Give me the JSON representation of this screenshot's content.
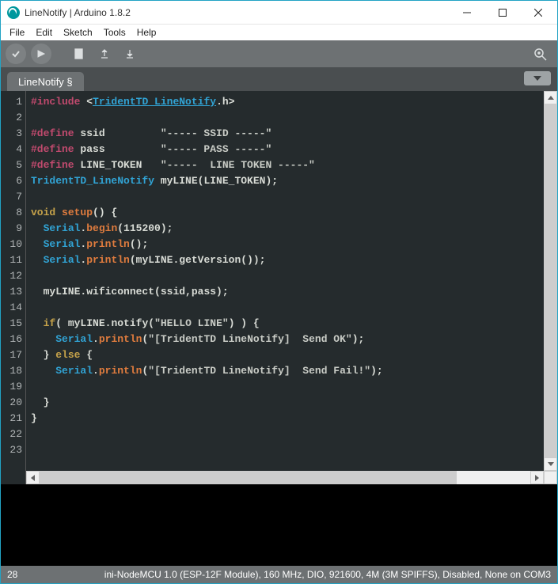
{
  "titlebar": {
    "title": "LineNotify | Arduino 1.8.2"
  },
  "menubar": {
    "items": [
      "File",
      "Edit",
      "Sketch",
      "Tools",
      "Help"
    ]
  },
  "tab": {
    "label": "LineNotify §"
  },
  "code": {
    "lines": [
      [
        [
          "c-prep",
          "#include"
        ],
        [
          "c-punc",
          " <"
        ],
        [
          "c-inc",
          "TridentTD_LineNotify"
        ],
        [
          "c-punc",
          "."
        ],
        [
          "c-ident",
          "h"
        ],
        [
          "c-punc",
          ">"
        ]
      ],
      [],
      [
        [
          "c-prep",
          "#define"
        ],
        [
          "c-ident",
          " ssid         "
        ],
        [
          "c-str",
          "\"----- SSID -----\""
        ]
      ],
      [
        [
          "c-prep",
          "#define"
        ],
        [
          "c-ident",
          " pass         "
        ],
        [
          "c-str",
          "\"----- PASS -----\""
        ]
      ],
      [
        [
          "c-prep",
          "#define"
        ],
        [
          "c-ident",
          " LINE_TOKEN   "
        ],
        [
          "c-str",
          "\"-----  LINE TOKEN -----\""
        ]
      ],
      [
        [
          "c-type",
          "TridentTD_LineNotify"
        ],
        [
          "c-ident",
          " myLINE"
        ],
        [
          "c-punc",
          "("
        ],
        [
          "c-ident",
          "LINE_TOKEN"
        ],
        [
          "c-punc",
          ");"
        ]
      ],
      [],
      [
        [
          "c-kw",
          "void"
        ],
        [
          "c-punc",
          " "
        ],
        [
          "c-kw2",
          "setup"
        ],
        [
          "c-punc",
          "() {"
        ]
      ],
      [
        [
          "c-punc",
          "  "
        ],
        [
          "c-serial",
          "Serial"
        ],
        [
          "c-punc",
          "."
        ],
        [
          "c-call",
          "begin"
        ],
        [
          "c-punc",
          "(115200);"
        ]
      ],
      [
        [
          "c-punc",
          "  "
        ],
        [
          "c-serial",
          "Serial"
        ],
        [
          "c-punc",
          "."
        ],
        [
          "c-call",
          "println"
        ],
        [
          "c-punc",
          "();"
        ]
      ],
      [
        [
          "c-punc",
          "  "
        ],
        [
          "c-serial",
          "Serial"
        ],
        [
          "c-punc",
          "."
        ],
        [
          "c-call",
          "println"
        ],
        [
          "c-punc",
          "(myLINE."
        ],
        [
          "c-ident",
          "getVersion"
        ],
        [
          "c-punc",
          "());"
        ]
      ],
      [],
      [
        [
          "c-punc",
          "  myLINE."
        ],
        [
          "c-ident",
          "wificonnect"
        ],
        [
          "c-punc",
          "(ssid,pass);"
        ]
      ],
      [],
      [
        [
          "c-punc",
          "  "
        ],
        [
          "c-kw",
          "if"
        ],
        [
          "c-punc",
          "( myLINE."
        ],
        [
          "c-ident",
          "notify"
        ],
        [
          "c-punc",
          "("
        ],
        [
          "c-str",
          "\"HELLO LINE\""
        ],
        [
          "c-punc",
          ") ) {"
        ]
      ],
      [
        [
          "c-punc",
          "    "
        ],
        [
          "c-serial",
          "Serial"
        ],
        [
          "c-punc",
          "."
        ],
        [
          "c-call",
          "println"
        ],
        [
          "c-punc",
          "("
        ],
        [
          "c-str",
          "\"[TridentTD LineNotify]  Send OK\""
        ],
        [
          "c-punc",
          ");"
        ]
      ],
      [
        [
          "c-punc",
          "  } "
        ],
        [
          "c-kw",
          "else"
        ],
        [
          "c-punc",
          " {"
        ]
      ],
      [
        [
          "c-punc",
          "    "
        ],
        [
          "c-serial",
          "Serial"
        ],
        [
          "c-punc",
          "."
        ],
        [
          "c-call",
          "println"
        ],
        [
          "c-punc",
          "("
        ],
        [
          "c-str",
          "\"[TridentTD LineNotify]  Send Fail!\""
        ],
        [
          "c-punc",
          ");"
        ]
      ],
      [],
      [
        [
          "c-punc",
          "  }"
        ]
      ],
      [
        [
          "c-punc",
          "}"
        ]
      ]
    ]
  },
  "status": {
    "cursor": "28",
    "board": "ini-NodeMCU 1.0 (ESP-12F Module), 160 MHz, DIO, 921600, 4M (3M SPIFFS), Disabled, None on COM3"
  }
}
